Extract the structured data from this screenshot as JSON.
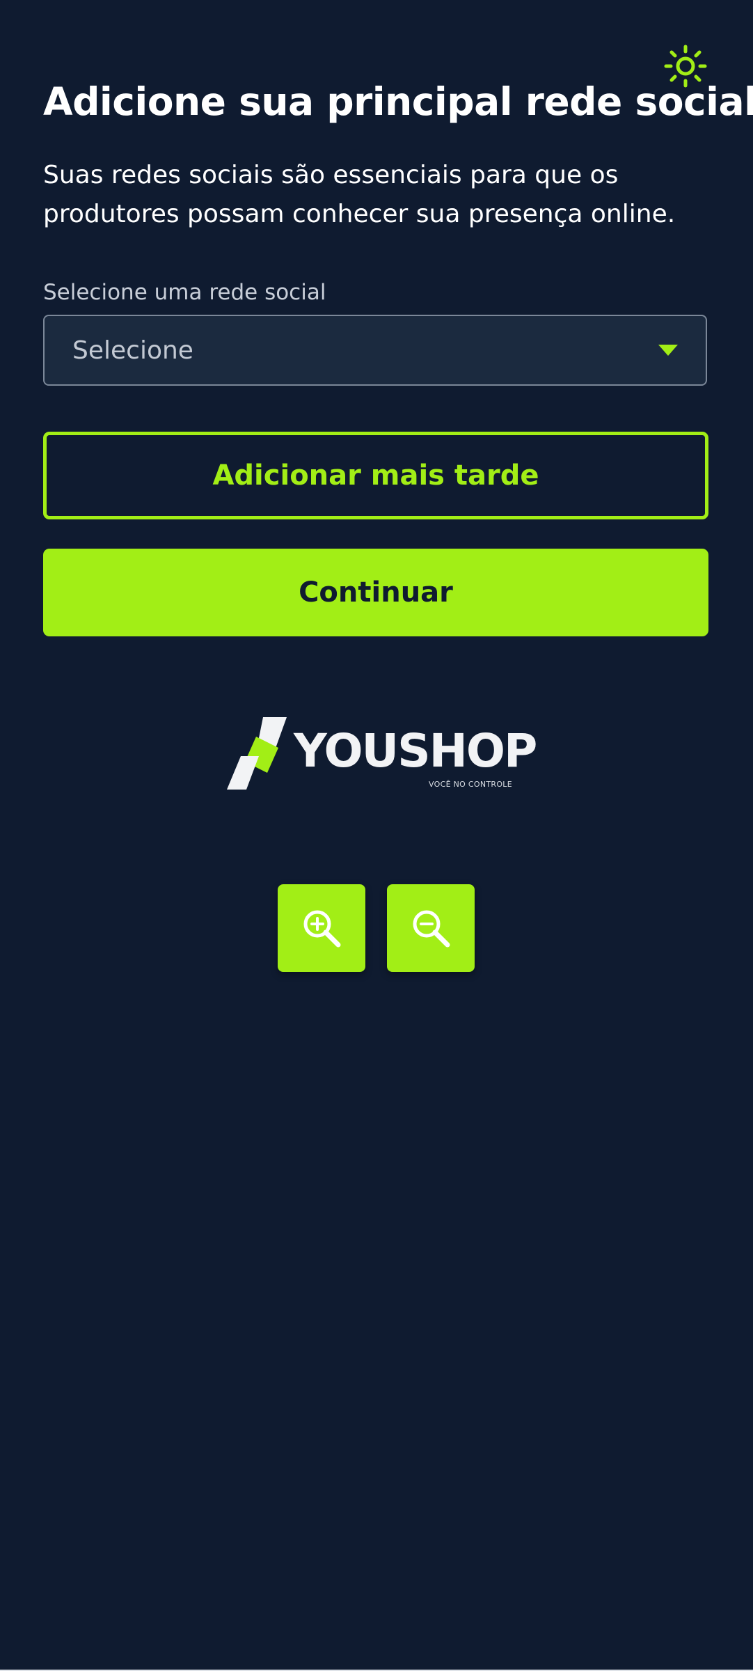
{
  "header": {
    "theme_toggle_icon": "sun-icon",
    "title": "Adicione sua principal rede social",
    "subtitle": "Suas redes sociais são essenciais para que os produtores possam conhecer sua presença online."
  },
  "form": {
    "social_network_label": "Selecione uma rede social",
    "social_network_select": {
      "value": "Selecione",
      "icon": "caret-down-icon"
    }
  },
  "actions": {
    "add_later_label": "Adicionar mais tarde",
    "continue_label": "Continuar"
  },
  "brand": {
    "name": "YOUSHOP",
    "tagline": "VOCÊ NO CONTROLE"
  },
  "zoom_controls": {
    "zoom_in_icon": "zoom-in-icon",
    "zoom_out_icon": "zoom-out-icon"
  },
  "colors": {
    "background": "#0f1b30",
    "accent": "#a2ee16",
    "text": "#ffffff",
    "select_background": "#1b2a3f"
  }
}
